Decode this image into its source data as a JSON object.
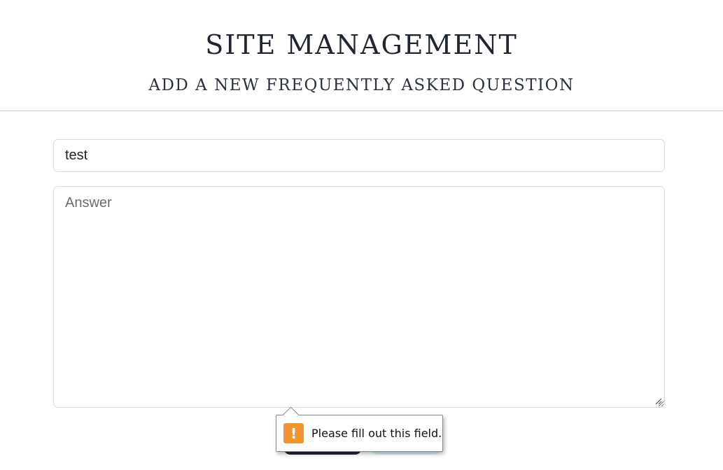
{
  "header": {
    "title": "SITE MANAGEMENT",
    "subtitle": "ADD A NEW FREQUENTLY ASKED QUESTION"
  },
  "form": {
    "question": {
      "value": "test"
    },
    "answer": {
      "value": "",
      "placeholder": "Answer"
    }
  },
  "validation": {
    "message": "Please fill out this field.",
    "icon": "exclamation-icon",
    "icon_symbol": "!",
    "icon_color": "#f29430"
  },
  "colors": {
    "title": "#1f2533",
    "primary_button": "#1f2533",
    "secondary_button": "#d9ecf3"
  }
}
